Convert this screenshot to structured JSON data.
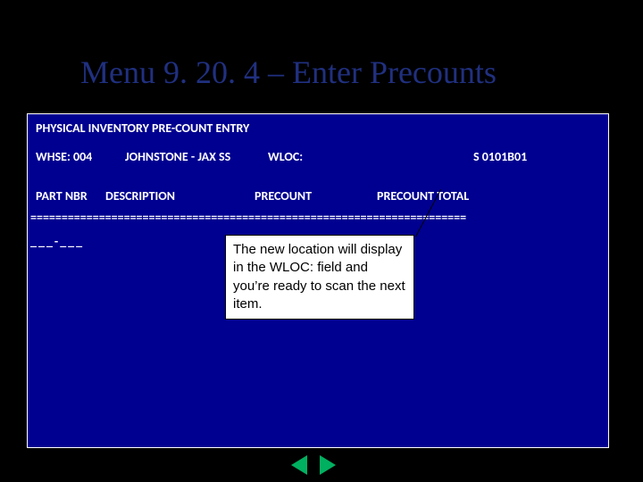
{
  "title": "Menu 9. 20. 4 – Enter Precounts",
  "screen": {
    "header": "PHYSICAL INVENTORY PRE-COUNT ENTRY",
    "whse_label": "WHSE: 004",
    "whse_name": "JOHNSTONE - JAX SS",
    "wloc_label": "WLOC:",
    "slot": "S 0101B01",
    "col_part": "PART NBR",
    "col_desc": "DESCRIPTION",
    "col_precount": "PRECOUNT",
    "col_precount_total": "PRECOUNT TOTAL",
    "eqline": "======================================================================",
    "prompt": "___-___"
  },
  "callout": "The new location will display in the WLOC: field and you’re ready to scan the next item.",
  "nav": {
    "prev": "previous slide",
    "next": "next slide"
  }
}
